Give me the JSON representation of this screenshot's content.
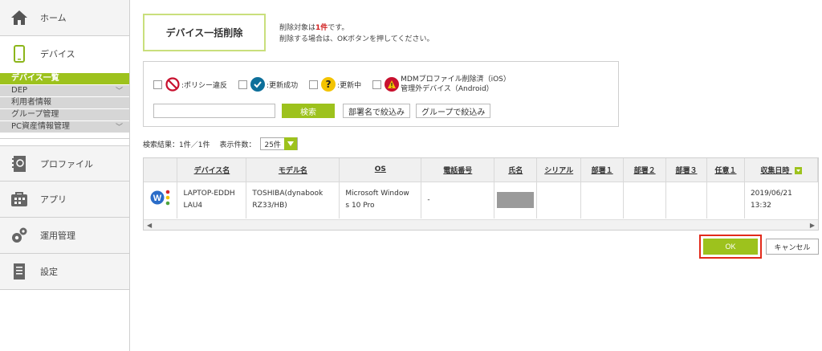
{
  "sidebar": {
    "home": "ホーム",
    "devices": "デバイス",
    "sub_items": [
      {
        "label": "デバイス一覧",
        "active": true
      },
      {
        "label": "DEP",
        "chevron": true
      },
      {
        "label": "利用者情報"
      },
      {
        "label": "グループ管理"
      },
      {
        "label": "PC資産情報管理",
        "chevron": true
      }
    ],
    "profiles": "プロファイル",
    "apps": "アプリ",
    "operations": "運用管理",
    "settings": "設定"
  },
  "page": {
    "title": "デバイス一括削除",
    "notice_prefix": "削除対象は",
    "notice_count": "1件",
    "notice_suffix": "です。",
    "notice_line2": "削除する場合は、OKボタンを押してください。"
  },
  "filters": {
    "policy_violation": ":ポリシー違反",
    "update_success": ":更新成功",
    "updating": ":更新中",
    "mdm_removed_line1": "MDMプロファイル削除済（iOS）",
    "mdm_removed_line2": "管理外デバイス（Android）",
    "search_value": "",
    "search_button": "検索",
    "filter_dept_button": "部署名で絞込み",
    "filter_group_button": "グループで絞込み"
  },
  "results": {
    "label": "検索結果：1件／1件",
    "per_page_label": "表示件数：",
    "per_page_value": "25件"
  },
  "table": {
    "headers": [
      "",
      "デバイス名",
      "モデル名",
      "OS",
      "電話番号",
      "氏名",
      "シリアル",
      "部署１",
      "部署２",
      "部署３",
      "任意１",
      "収集日時"
    ],
    "row": {
      "device_name_l1": "LAPTOP-EDDH",
      "device_name_l2": "LAU4",
      "model_l1": "TOSHIBA(dynabook",
      "model_l2": "RZ33/HB)",
      "os_l1": "Microsoft Window",
      "os_l2": "s 10 Pro",
      "phone": "-",
      "collected_l1": "2019/06/21",
      "collected_l2": "13:32"
    }
  },
  "actions": {
    "ok": "OK",
    "cancel": "キャンセル"
  },
  "colors": {
    "accent": "#9dc21d",
    "highlight": "#e22a1a"
  }
}
